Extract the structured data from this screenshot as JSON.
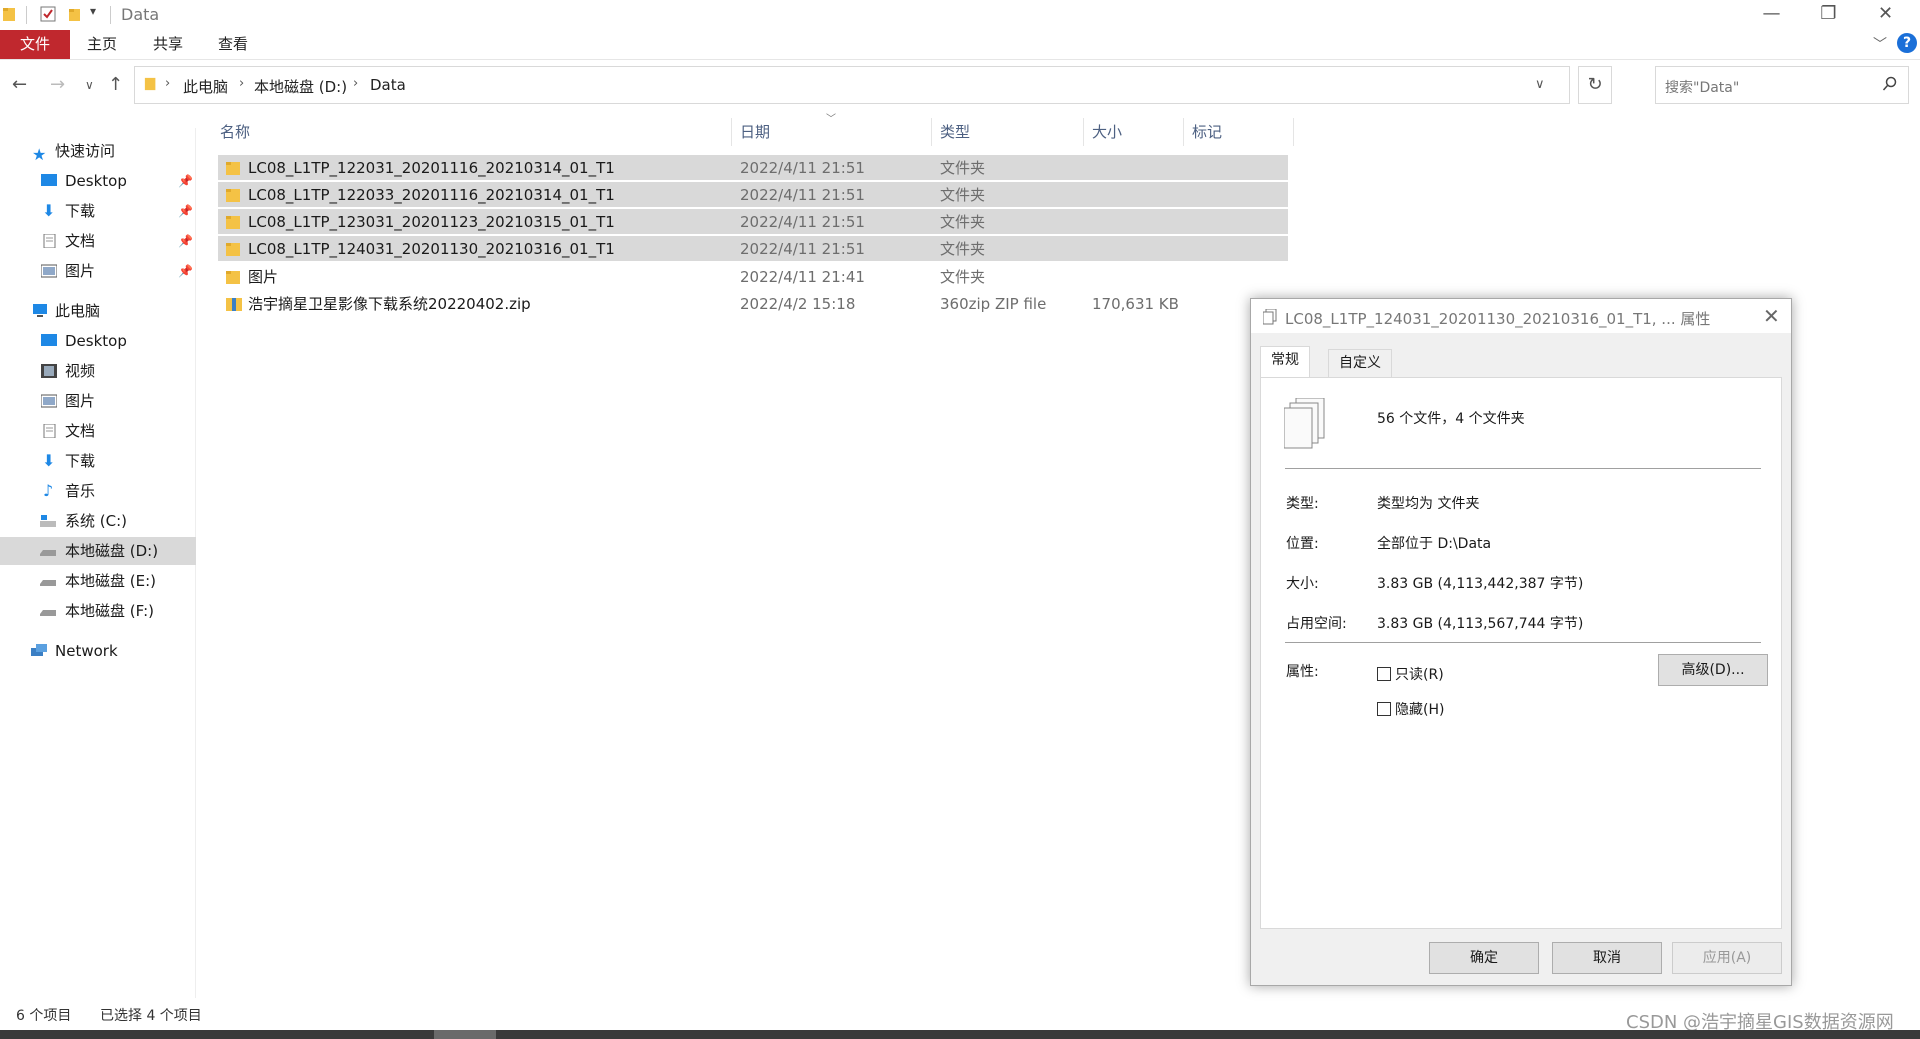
{
  "window": {
    "title": "Data",
    "ribbon_tabs": [
      "文件",
      "主页",
      "共享",
      "查看"
    ]
  },
  "address": {
    "crumbs": [
      "此电脑",
      "本地磁盘 (D:)",
      "Data"
    ],
    "search_placeholder": "搜索\"Data\""
  },
  "nav": {
    "quick_access": "快速访问",
    "quick_items": [
      "Desktop",
      "下载",
      "文档",
      "图片"
    ],
    "this_pc": "此电脑",
    "pc_items": [
      "Desktop",
      "视频",
      "图片",
      "文档",
      "下载",
      "音乐",
      "系统 (C:)",
      "本地磁盘 (D:)",
      "本地磁盘 (E:)",
      "本地磁盘 (F:)"
    ],
    "network": "Network"
  },
  "columns": [
    "名称",
    "日期",
    "类型",
    "大小",
    "标记"
  ],
  "files": [
    {
      "name": "LC08_L1TP_122031_20201116_20210314_01_T1",
      "date": "2022/4/11 21:51",
      "type": "文件夹",
      "size": "",
      "selected": true
    },
    {
      "name": "LC08_L1TP_122033_20201116_20210314_01_T1",
      "date": "2022/4/11 21:51",
      "type": "文件夹",
      "size": "",
      "selected": true
    },
    {
      "name": "LC08_L1TP_123031_20201123_20210315_01_T1",
      "date": "2022/4/11 21:51",
      "type": "文件夹",
      "size": "",
      "selected": true
    },
    {
      "name": "LC08_L1TP_124031_20201130_20210316_01_T1",
      "date": "2022/4/11 21:51",
      "type": "文件夹",
      "size": "",
      "selected": true
    },
    {
      "name": "图片",
      "date": "2022/4/11 21:41",
      "type": "文件夹",
      "size": "",
      "selected": false
    },
    {
      "name": "浩宇摘星卫星影像下载系统20220402.zip",
      "date": "2022/4/2 15:18",
      "type": "360zip ZIP file",
      "size": "170,631 KB",
      "selected": false
    }
  ],
  "status": {
    "count": "6 个项目",
    "selection": "已选择 4 个项目"
  },
  "watermark": "CSDN @浩宇摘星GIS数据资源网",
  "dialog": {
    "title": "LC08_L1TP_124031_20201130_20210316_01_T1, ... 属性",
    "tabs": [
      "常规",
      "自定义"
    ],
    "summary": "56 个文件，4 个文件夹",
    "rows": [
      {
        "label": "类型:",
        "value": "类型均为 文件夹"
      },
      {
        "label": "位置:",
        "value": "全部位于 D:\\Data"
      },
      {
        "label": "大小:",
        "value": "3.83 GB (4,113,442,387 字节)"
      },
      {
        "label": "占用空间:",
        "value": "3.83 GB (4,113,567,744 字节)"
      }
    ],
    "attributes_label": "属性:",
    "readonly_label": "只读(R)",
    "hidden_label": "隐藏(H)",
    "advanced_label": "高级(D)...",
    "ok_label": "确定",
    "cancel_label": "取消",
    "apply_label": "应用(A)"
  }
}
